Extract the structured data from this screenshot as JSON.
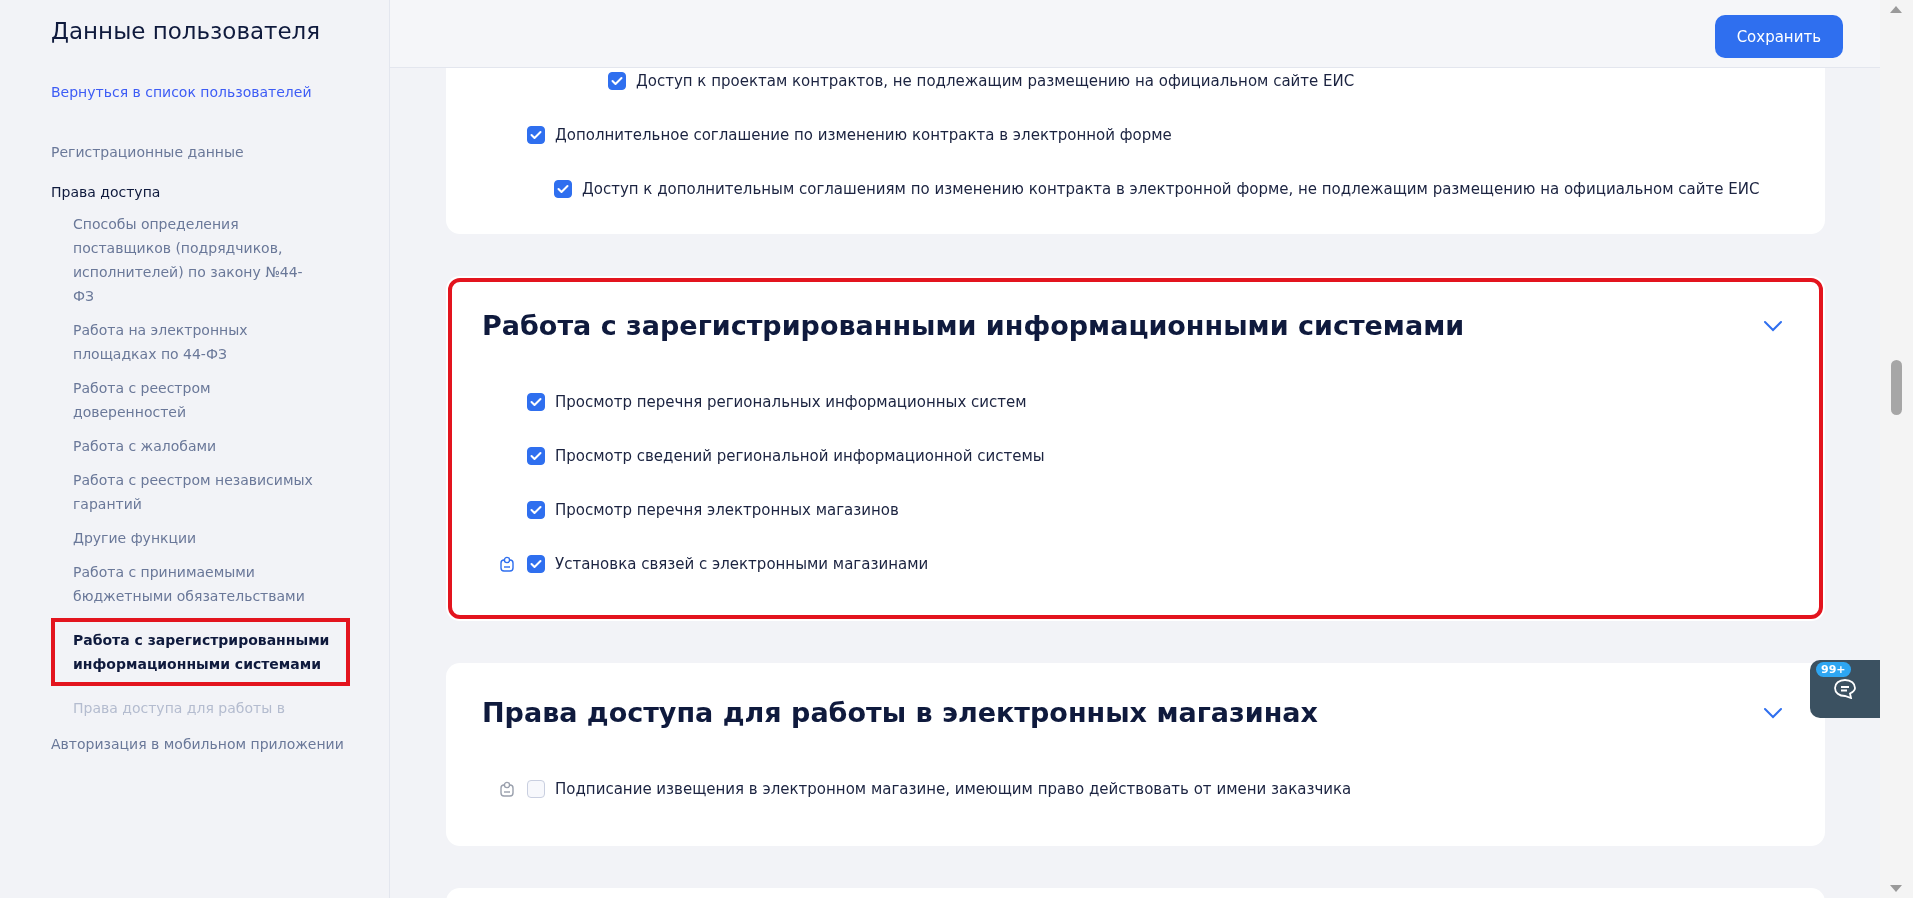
{
  "sidebar": {
    "title": "Данные пользователя",
    "back_link": "Вернуться в список пользователей",
    "items": [
      {
        "label": "Регистрационные данные",
        "selected": false
      },
      {
        "label": "Права доступа",
        "selected": true,
        "children": [
          {
            "label": "Способы определения поставщиков (подрядчиков, исполнителей) по закону №44-ФЗ",
            "selected": false,
            "highlighted": false,
            "faded": false
          },
          {
            "label": "Работа на электронных площадках по 44-ФЗ",
            "selected": false,
            "highlighted": false,
            "faded": false
          },
          {
            "label": "Работа с реестром доверенностей",
            "selected": false,
            "highlighted": false,
            "faded": false
          },
          {
            "label": "Работа с жалобами",
            "selected": false,
            "highlighted": false,
            "faded": false
          },
          {
            "label": "Работа с реестром независимых гарантий",
            "selected": false,
            "highlighted": false,
            "faded": false
          },
          {
            "label": "Другие функции",
            "selected": false,
            "highlighted": false,
            "faded": false
          },
          {
            "label": "Работа с принимаемыми бюджетными обязательствами",
            "selected": false,
            "highlighted": false,
            "faded": false
          },
          {
            "label": "Работа с зарегистрированными информационными системами",
            "selected": true,
            "highlighted": true,
            "faded": false
          },
          {
            "label": "Права доступа для работы в",
            "selected": false,
            "highlighted": false,
            "faded": true
          }
        ]
      },
      {
        "label": "Авторизация в мобильном приложении",
        "selected": false
      }
    ]
  },
  "save_button": "Сохранить",
  "sections": [
    {
      "highlighted": false,
      "items": [
        {
          "children": [
            {
              "label": "Доступ к проектам контрактов, не подлежащим размещению на официальном сайте ЕИС",
              "checked": true,
              "flagged": false
            }
          ]
        },
        {
          "label": "Дополнительное соглашение по изменению контракта в электронной форме",
          "checked": true,
          "flagged": false,
          "children": [
            {
              "label": "Доступ к дополнительным соглашениям по изменению контракта в электронной форме, не подлежащим размещению на официальном сайте ЕИС",
              "checked": true,
              "flagged": false
            }
          ]
        }
      ]
    },
    {
      "title": "Работа с зарегистрированными информационными системами",
      "highlighted": true,
      "expanded": true,
      "items": [
        {
          "label": "Просмотр перечня региональных информационных систем",
          "checked": true,
          "flagged": false
        },
        {
          "label": "Просмотр сведений региональной информационной системы",
          "checked": true,
          "flagged": false
        },
        {
          "label": "Просмотр перечня электронных магазинов",
          "checked": true,
          "flagged": false
        },
        {
          "label": "Установка связей с электронными магазинами",
          "checked": true,
          "flagged": true
        }
      ]
    },
    {
      "title": "Права доступа для работы в электронных магазинах",
      "highlighted": false,
      "expanded": true,
      "items": [
        {
          "label": "Подписание извещения в электронном магазине, имеющим право действовать от имени заказчика",
          "checked": false,
          "flagged": true
        }
      ]
    }
  ],
  "chat": {
    "badge": "99+"
  }
}
